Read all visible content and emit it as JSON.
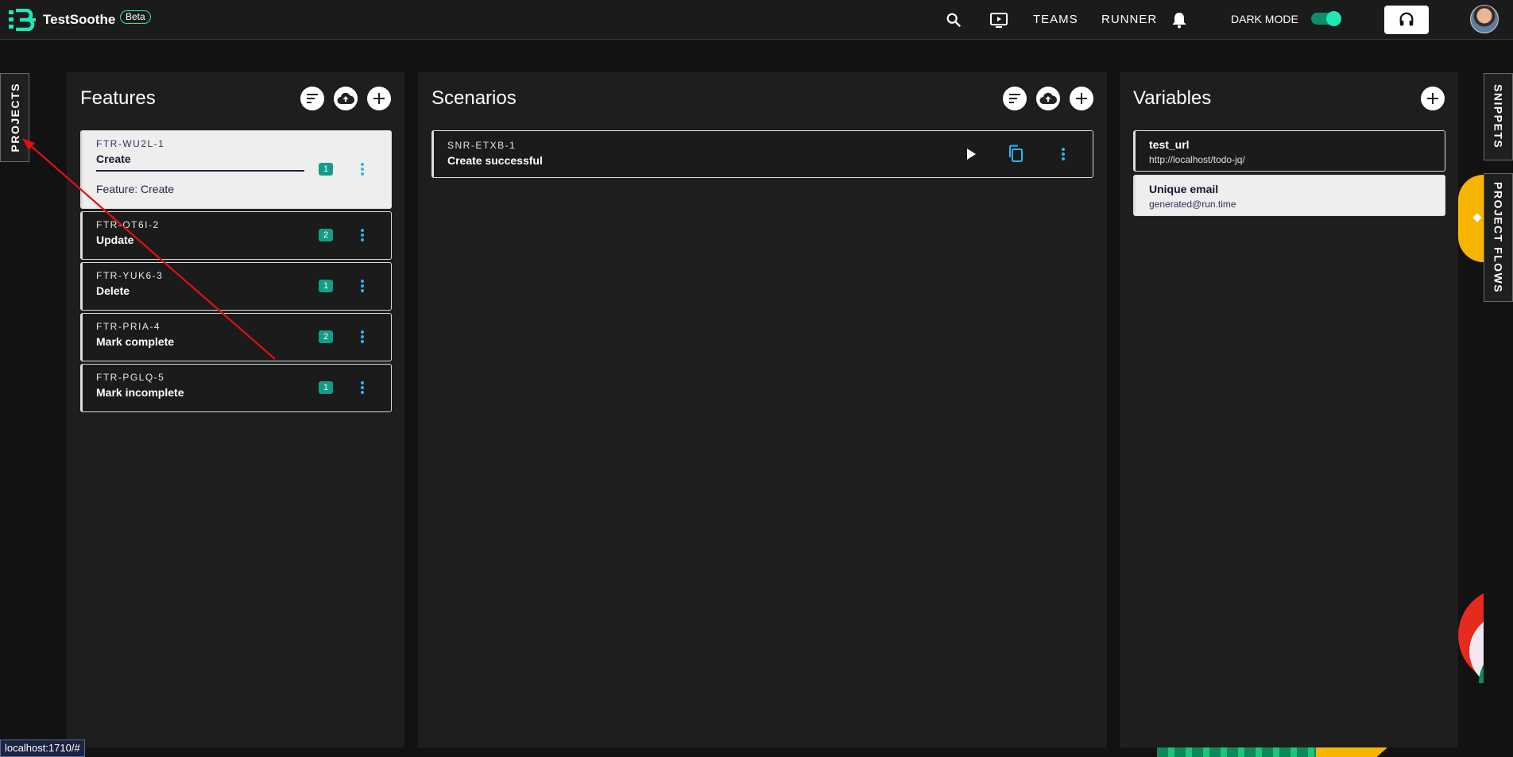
{
  "app": {
    "brand": "TestSoothe",
    "beta_label": "Beta"
  },
  "topbar": {
    "teams_label": "TEAMS",
    "runner_label": "RUNNER",
    "dark_mode_label": "DARK MODE",
    "dark_mode_on": true,
    "icons": [
      "search-icon",
      "screen-play-icon",
      "bell-icon",
      "headset-icon"
    ]
  },
  "side_tabs": {
    "projects": "PROJECTS",
    "snippets": "SNIPPETS",
    "project_flows": "PROJECT FLOWS"
  },
  "features": {
    "title": "Features",
    "items": [
      {
        "code": "FTR-WU2L-1",
        "name": "Create",
        "count": "1",
        "description": "Feature: Create",
        "active": true
      },
      {
        "code": "FTR-OT6I-2",
        "name": "Update",
        "count": "2"
      },
      {
        "code": "FTR-YUK6-3",
        "name": "Delete",
        "count": "1"
      },
      {
        "code": "FTR-PRIA-4",
        "name": "Mark complete",
        "count": "2"
      },
      {
        "code": "FTR-PGLQ-5",
        "name": "Mark incomplete",
        "count": "1"
      }
    ]
  },
  "scenarios": {
    "title": "Scenarios",
    "items": [
      {
        "code": "SNR-ETXB-1",
        "name": "Create successful"
      }
    ]
  },
  "variables": {
    "title": "Variables",
    "items": [
      {
        "name": "test_url",
        "value": "http://localhost/todo-jq/"
      },
      {
        "name": "Unique email",
        "value": "generated@run.time",
        "active": true
      }
    ]
  },
  "status_bar": {
    "url": "localhost:1710/#"
  },
  "colors": {
    "accent": "#1de9b6",
    "badge": "#119e88",
    "kebab": "#29b6f6",
    "annotation_arrow": "#e01010"
  }
}
